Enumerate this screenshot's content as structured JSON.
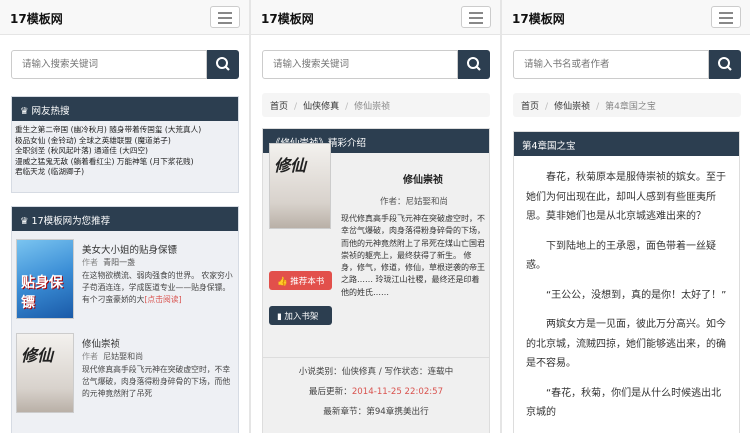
{
  "brand": "17模板网",
  "panel1": {
    "search_placeholder": "请输入搜索关键词",
    "hot": {
      "title": "网友热搜",
      "lines": [
        "重生之第二帝国 (幽冷秋月)  随身带着传国玺 (大荒真人)",
        "极品女仙 (金铃动)  全球之英雄联盟 (魔道弟子)",
        "全职剑圣 (秋风起叶落)  通道佳 (大四空)",
        "漫威之猛鬼无敌 (躺着看红尘)  万能神笔 (月下浆花贱)",
        "君临天龙 (临湖卿子)"
      ]
    },
    "recommend": {
      "title": "17模板网为您推荐",
      "items": [
        {
          "title": "美女大小姐的贴身保镖",
          "author_label": "作者",
          "author": "青阳一盏",
          "desc": "在这物欲横流、弱肉强食的世界。  农家穷小子苟酒连连，学成医道专业——贴身保镖。  有个刁蛮豪娇的大",
          "more": "[点击阅读]",
          "cover_text": "贴身保镖"
        },
        {
          "title": "修仙崇祯",
          "author_label": "作者",
          "author": "尼姑娶和尚",
          "desc": "现代修真高手段飞元神在突破虚空时，不幸岔气爆破，肉身落得粉身碎骨的下场，而他的元神竟然附了吊死",
          "more": "",
          "cover_text": "修仙"
        }
      ]
    }
  },
  "panel2": {
    "search_placeholder": "请输入搜索关键词",
    "crumbs": [
      "首页",
      "仙侠修真",
      "修仙崇祯"
    ],
    "intro_title": "《修仙崇祯》精彩介绍",
    "book_title": "修仙崇祯",
    "author_label": "作者：",
    "author": "尼姑娶和尚",
    "cover_text": "修仙",
    "desc": "现代修真高手段飞元神在突破虚空时，不幸岔气爆破，肉身落得粉身碎骨的下场，而他的元神竟然附上了吊死在煤山亡国君崇祯的躯壳上，最终获得了新生。  修身，修气，修道，修仙，草根逆袭的帝王之路……  玲珑江山社稷，最终还是印着他的姓氏……",
    "btn_recommend": "推荐本书",
    "btn_shelf": "加入书架",
    "meta_category": "小说类别：仙侠修真 / 写作状态：连载中",
    "meta_updated_label": "最后更新：",
    "meta_updated": "2014-11-25 22:02:57",
    "meta_latest": "最新章节：第94章携美出行"
  },
  "panel3": {
    "search_placeholder": "请输入书名或者作者",
    "crumbs": [
      "首页",
      "修仙崇祯",
      "第4章国之宝"
    ],
    "chapter_title": "第4章国之宝",
    "paragraphs": [
      "春花，秋菊原本是服侍崇祯的嫔女。至于她们为何出现在此，却叫人感到有些匪夷所思。莫非她们也是从北京城逃难出来的？",
      "下到陆地上的王承恩，面色带着一丝疑惑。",
      "“王公公，没想到，真的是你！太好了！”",
      "两嫔女方是一见面，彼此万分高兴。如今的北京城，流贼四掠，她们能够逃出来，的确是不容易。",
      "“春花，秋菊，你们是从什么时候逃出北京城的"
    ]
  }
}
